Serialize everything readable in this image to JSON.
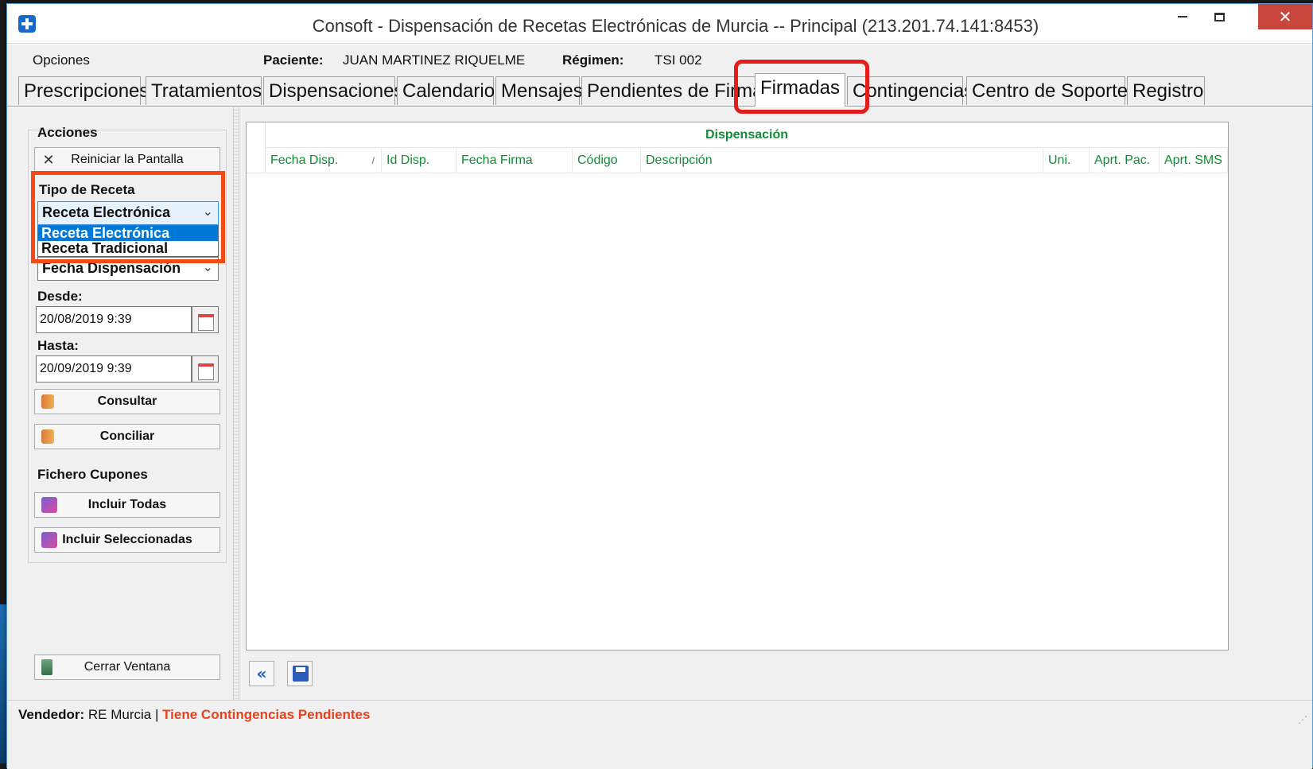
{
  "window": {
    "title": "Consoft - Dispensación de Recetas Electrónicas de Murcia  -- Principal (213.201.74.141:8453)",
    "close_glyph": "✕"
  },
  "info": {
    "menu": "Opciones",
    "patient_label": "Paciente:",
    "patient_value": "JUAN MARTINEZ RIQUELME",
    "regime_label": "Régimen:",
    "regime_value": "TSI 002"
  },
  "tabs": [
    {
      "label": "Prescripciones"
    },
    {
      "label": "Tratamientos"
    },
    {
      "label": "Dispensaciones"
    },
    {
      "label": "Calendario"
    },
    {
      "label": "Mensajes"
    },
    {
      "label": "Pendientes de Firma"
    },
    {
      "label": "Firmadas",
      "active": true
    },
    {
      "label": "Contingencias"
    },
    {
      "label": "Centro de Soporte"
    },
    {
      "label": "Registro"
    }
  ],
  "left": {
    "actions_label": "Acciones",
    "reset_button": "Reiniciar la Pantalla",
    "recipe_type_label": "Tipo de Receta",
    "recipe_type_selected": "Receta Electrónica",
    "recipe_type_options": [
      "Receta Electrónica",
      "Receta Tradicional"
    ],
    "date_field_selected": "Fecha Dispensación",
    "from_label": "Desde:",
    "from_value": "20/08/2019 9:39",
    "to_label": "Hasta:",
    "to_value": "20/09/2019 9:39",
    "query_button": "Consultar",
    "reconcile_button": "Conciliar",
    "coupons_label": "Fichero Cupones",
    "include_all_button": "Incluir Todas",
    "include_selected_button": "Incluir Seleccionadas",
    "close_button": "Cerrar Ventana"
  },
  "grid": {
    "band": "Dispensación",
    "columns": [
      "Fecha Disp.",
      "Id Disp.",
      "Fecha Firma",
      "Código",
      "Descripción",
      "Uni.",
      "Aprt. Pac.",
      "Aprt. SMS"
    ],
    "rows": []
  },
  "nav": {
    "back_glyph": "«"
  },
  "status": {
    "seller_label": "Vendedor:",
    "seller_value": "RE Murcia",
    "separator": "|",
    "warning": "Tiene Contingencias Pendientes"
  },
  "colors": {
    "accent_green": "#138a36",
    "highlight_red": "#e41c1c",
    "warning_orange": "#e8411c"
  }
}
